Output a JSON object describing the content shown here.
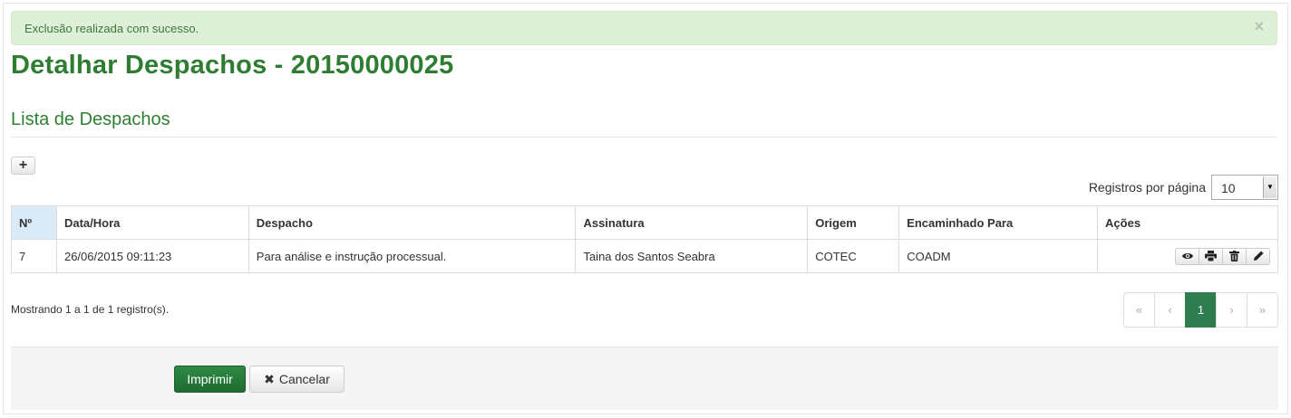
{
  "alert": {
    "message": "Exclusão realizada com sucesso.",
    "close": "×"
  },
  "page": {
    "title": "Detalhar Despachos - 20150000025"
  },
  "section": {
    "title": "Lista de Despachos"
  },
  "toolbar": {
    "add_label": "+"
  },
  "pagination_size": {
    "label": "Registros por página",
    "value": "10"
  },
  "table": {
    "headers": [
      "Nº",
      "Data/Hora",
      "Despacho",
      "Assinatura",
      "Origem",
      "Encaminhado Para",
      "Ações"
    ],
    "rows": [
      [
        "7",
        "26/06/2015 09:11:23",
        "Para análise e instrução processual.",
        "Taina dos Santos Seabra",
        "COTEC",
        "COADM"
      ]
    ],
    "row_actions": [
      "eye-icon",
      "print-icon",
      "trash-icon",
      "pencil-icon"
    ]
  },
  "info": {
    "text": "Mostrando 1 a 1 de 1 registro(s)."
  },
  "pager": {
    "first": "«",
    "prev": "‹",
    "current": "1",
    "next": "›",
    "last": "»"
  },
  "footer": {
    "print_label": "Imprimir",
    "cancel_label": "Cancelar"
  },
  "colors": {
    "brand_green": "#2e7d32",
    "active_page": "#2e7d4f",
    "alert_bg": "#dff0d8",
    "header_highlight": "#dbeaf7"
  }
}
